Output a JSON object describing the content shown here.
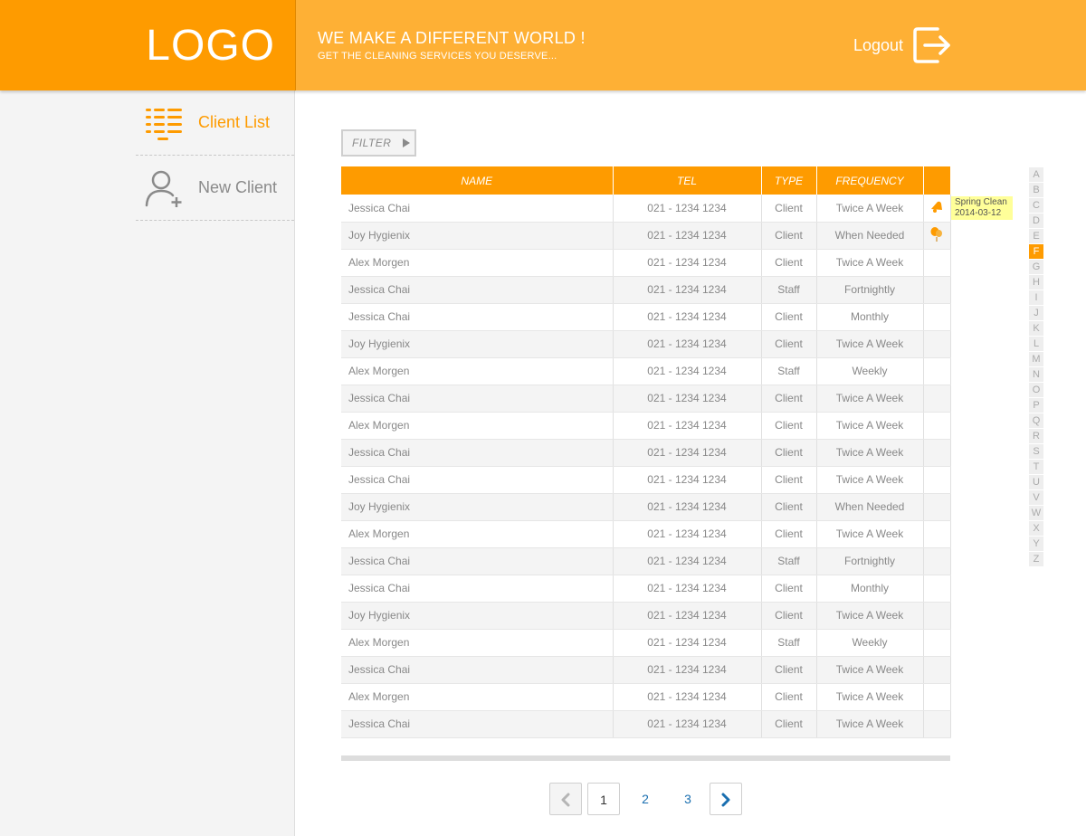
{
  "header": {
    "logo": "LOGO",
    "tagline": "WE MAKE A DIFFERENT WORLD !",
    "subtagline": "GET THE CLEANING SERVICES YOU DESERVE...",
    "logout_label": "Logout"
  },
  "sidebar": {
    "items": [
      {
        "label": "Client List",
        "icon": "list-icon",
        "active": true
      },
      {
        "label": "New Client",
        "icon": "add-user-icon",
        "active": false
      }
    ]
  },
  "filter": {
    "label": "FILTER"
  },
  "table": {
    "columns": [
      "NAME",
      "TEL",
      "TYPE",
      "FREQUENCY",
      ""
    ],
    "rows": [
      {
        "name": "Jessica Chai",
        "tel": "021 - 1234 1234",
        "type": "Client",
        "frequency": "Twice A Week",
        "flag": "bell-icon"
      },
      {
        "name": "Joy Hygienix",
        "tel": "021 - 1234 1234",
        "type": "Client",
        "frequency": "When Needed",
        "flag": "balloon-icon"
      },
      {
        "name": "Alex Morgen",
        "tel": "021 - 1234 1234",
        "type": "Client",
        "frequency": "Twice A Week",
        "flag": ""
      },
      {
        "name": "Jessica Chai",
        "tel": "021 - 1234 1234",
        "type": "Staff",
        "frequency": "Fortnightly",
        "flag": ""
      },
      {
        "name": "Jessica Chai",
        "tel": "021 - 1234 1234",
        "type": "Client",
        "frequency": "Monthly",
        "flag": ""
      },
      {
        "name": "Joy Hygienix",
        "tel": "021 - 1234 1234",
        "type": "Client",
        "frequency": "Twice A Week",
        "flag": ""
      },
      {
        "name": "Alex Morgen",
        "tel": "021 - 1234 1234",
        "type": "Staff",
        "frequency": "Weekly",
        "flag": ""
      },
      {
        "name": "Jessica Chai",
        "tel": "021 - 1234 1234",
        "type": "Client",
        "frequency": "Twice A Week",
        "flag": ""
      },
      {
        "name": "Alex Morgen",
        "tel": "021 - 1234 1234",
        "type": "Client",
        "frequency": "Twice A Week",
        "flag": ""
      },
      {
        "name": "Jessica Chai",
        "tel": "021 - 1234 1234",
        "type": "Client",
        "frequency": "Twice A Week",
        "flag": ""
      },
      {
        "name": "Jessica Chai",
        "tel": "021 - 1234 1234",
        "type": "Client",
        "frequency": "Twice A Week",
        "flag": ""
      },
      {
        "name": "Joy Hygienix",
        "tel": "021 - 1234 1234",
        "type": "Client",
        "frequency": "When Needed",
        "flag": ""
      },
      {
        "name": "Alex Morgen",
        "tel": "021 - 1234 1234",
        "type": "Client",
        "frequency": "Twice A Week",
        "flag": ""
      },
      {
        "name": "Jessica Chai",
        "tel": "021 - 1234 1234",
        "type": "Staff",
        "frequency": "Fortnightly",
        "flag": ""
      },
      {
        "name": "Jessica Chai",
        "tel": "021 - 1234 1234",
        "type": "Client",
        "frequency": "Monthly",
        "flag": ""
      },
      {
        "name": "Joy Hygienix",
        "tel": "021 - 1234 1234",
        "type": "Client",
        "frequency": "Twice A Week",
        "flag": ""
      },
      {
        "name": "Alex Morgen",
        "tel": "021 - 1234 1234",
        "type": "Staff",
        "frequency": "Weekly",
        "flag": ""
      },
      {
        "name": "Jessica Chai",
        "tel": "021 - 1234 1234",
        "type": "Client",
        "frequency": "Twice A Week",
        "flag": ""
      },
      {
        "name": "Alex Morgen",
        "tel": "021 - 1234 1234",
        "type": "Client",
        "frequency": "Twice A Week",
        "flag": ""
      },
      {
        "name": "Jessica Chai",
        "tel": "021 - 1234 1234",
        "type": "Client",
        "frequency": "Twice A Week",
        "flag": ""
      }
    ]
  },
  "tooltip": {
    "line1": "Spring Clean",
    "line2": "2014-03-12"
  },
  "alphabet": {
    "letters": [
      "A",
      "B",
      "C",
      "D",
      "E",
      "F",
      "G",
      "H",
      "I",
      "J",
      "K",
      "L",
      "M",
      "N",
      "O",
      "P",
      "Q",
      "R",
      "S",
      "T",
      "U",
      "V",
      "W",
      "X",
      "Y",
      "Z"
    ],
    "active": "F"
  },
  "pagination": {
    "pages": [
      "1",
      "2",
      "3"
    ],
    "current": "1"
  },
  "colors": {
    "accent": "#fe9b00",
    "banner": "#feb035",
    "link": "#1a6fb0"
  }
}
